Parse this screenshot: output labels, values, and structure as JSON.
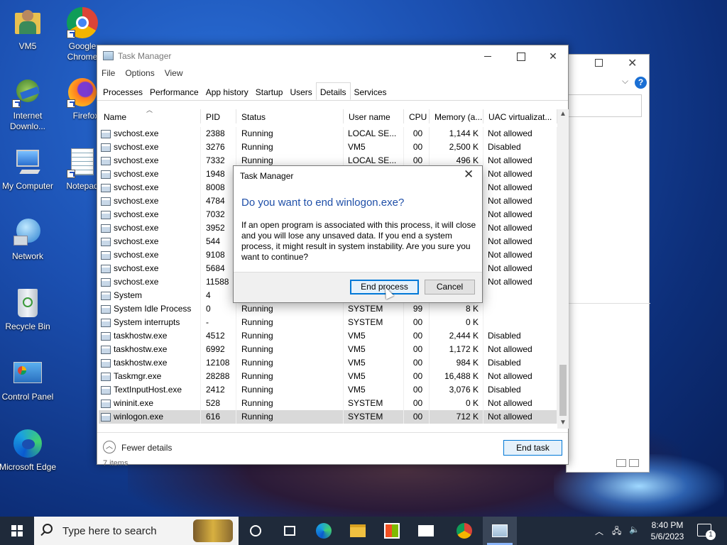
{
  "desktop": {
    "icons": [
      {
        "label": "VM5"
      },
      {
        "label": "Google Chrome"
      },
      {
        "label": "Internet Downlo..."
      },
      {
        "label": "Firefox"
      },
      {
        "label": "My Computer"
      },
      {
        "label": "Notepad"
      },
      {
        "label": "Network"
      },
      {
        "label": "Recycle Bin"
      },
      {
        "label": "Control Panel"
      },
      {
        "label": "Microsoft Edge"
      }
    ]
  },
  "task_manager": {
    "title": "Task Manager",
    "menu": [
      "File",
      "Options",
      "View"
    ],
    "tabs": [
      "Processes",
      "Performance",
      "App history",
      "Startup",
      "Users",
      "Details",
      "Services"
    ],
    "active_tab": "Details",
    "columns": [
      "Name",
      "PID",
      "Status",
      "User name",
      "CPU",
      "Memory (a...",
      "UAC virtualizat..."
    ],
    "rows": [
      {
        "name": "svchost.exe",
        "pid": "2388",
        "status": "Running",
        "user": "LOCAL SE...",
        "cpu": "00",
        "mem": "1,144 K",
        "uac": "Not allowed"
      },
      {
        "name": "svchost.exe",
        "pid": "3276",
        "status": "Running",
        "user": "VM5",
        "cpu": "00",
        "mem": "2,500 K",
        "uac": "Disabled"
      },
      {
        "name": "svchost.exe",
        "pid": "7332",
        "status": "Running",
        "user": "LOCAL SE...",
        "cpu": "00",
        "mem": "496 K",
        "uac": "Not allowed"
      },
      {
        "name": "svchost.exe",
        "pid": "1948",
        "status": "",
        "user": "",
        "cpu": "",
        "mem": "",
        "uac": "Not allowed"
      },
      {
        "name": "svchost.exe",
        "pid": "8008",
        "status": "",
        "user": "",
        "cpu": "",
        "mem": "",
        "uac": "Not allowed"
      },
      {
        "name": "svchost.exe",
        "pid": "4784",
        "status": "",
        "user": "",
        "cpu": "",
        "mem": "",
        "uac": "Not allowed"
      },
      {
        "name": "svchost.exe",
        "pid": "7032",
        "status": "",
        "user": "",
        "cpu": "",
        "mem": "",
        "uac": "Not allowed"
      },
      {
        "name": "svchost.exe",
        "pid": "3952",
        "status": "",
        "user": "",
        "cpu": "",
        "mem": "",
        "uac": "Not allowed"
      },
      {
        "name": "svchost.exe",
        "pid": "544",
        "status": "",
        "user": "",
        "cpu": "",
        "mem": "",
        "uac": "Not allowed"
      },
      {
        "name": "svchost.exe",
        "pid": "9108",
        "status": "",
        "user": "",
        "cpu": "",
        "mem": "",
        "uac": "Not allowed"
      },
      {
        "name": "svchost.exe",
        "pid": "5684",
        "status": "",
        "user": "",
        "cpu": "",
        "mem": "",
        "uac": "Not allowed"
      },
      {
        "name": "svchost.exe",
        "pid": "11588",
        "status": "",
        "user": "",
        "cpu": "",
        "mem": "",
        "uac": "Not allowed"
      },
      {
        "name": "System",
        "pid": "4",
        "status": "",
        "user": "",
        "cpu": "",
        "mem": "",
        "uac": ""
      },
      {
        "name": "System Idle Process",
        "pid": "0",
        "status": "Running",
        "user": "SYSTEM",
        "cpu": "99",
        "mem": "8 K",
        "uac": ""
      },
      {
        "name": "System interrupts",
        "pid": "-",
        "status": "Running",
        "user": "SYSTEM",
        "cpu": "00",
        "mem": "0 K",
        "uac": ""
      },
      {
        "name": "taskhostw.exe",
        "pid": "4512",
        "status": "Running",
        "user": "VM5",
        "cpu": "00",
        "mem": "2,444 K",
        "uac": "Disabled"
      },
      {
        "name": "taskhostw.exe",
        "pid": "6992",
        "status": "Running",
        "user": "VM5",
        "cpu": "00",
        "mem": "1,172 K",
        "uac": "Not allowed"
      },
      {
        "name": "taskhostw.exe",
        "pid": "12108",
        "status": "Running",
        "user": "VM5",
        "cpu": "00",
        "mem": "984 K",
        "uac": "Disabled"
      },
      {
        "name": "Taskmgr.exe",
        "pid": "28288",
        "status": "Running",
        "user": "VM5",
        "cpu": "00",
        "mem": "16,488 K",
        "uac": "Not allowed"
      },
      {
        "name": "TextInputHost.exe",
        "pid": "2412",
        "status": "Running",
        "user": "VM5",
        "cpu": "00",
        "mem": "3,076 K",
        "uac": "Disabled"
      },
      {
        "name": "wininit.exe",
        "pid": "528",
        "status": "Running",
        "user": "SYSTEM",
        "cpu": "00",
        "mem": "0 K",
        "uac": "Not allowed"
      },
      {
        "name": "winlogon.exe",
        "pid": "616",
        "status": "Running",
        "user": "SYSTEM",
        "cpu": "00",
        "mem": "712 K",
        "uac": "Not allowed",
        "selected": true
      }
    ],
    "footer": {
      "fewer_details": "Fewer details",
      "end_task": "End task"
    },
    "items_text": "7 items"
  },
  "dialog": {
    "title": "Task Manager",
    "question": "Do you want to end winlogon.exe?",
    "message": "If an open program is associated with this process, it will close and you will lose any unsaved data. If you end a system process, it might result in system instability. Are you sure you want to continue?",
    "end_button": "End process",
    "cancel_button": "Cancel"
  },
  "taskbar": {
    "search_placeholder": "Type here to search",
    "time": "8:40 PM",
    "date": "5/6/2023",
    "notification_count": "1"
  },
  "colors": {
    "accent": "#0078d7",
    "dialog_heading": "#1f4fa8",
    "taskbar": "#1f2a3a"
  }
}
